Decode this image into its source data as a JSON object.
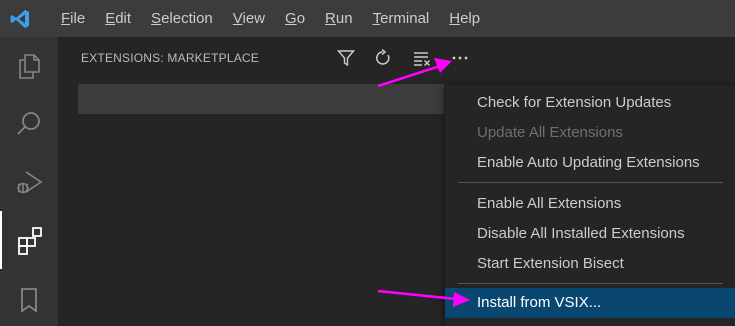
{
  "menubar": {
    "items": [
      {
        "pre": "",
        "mn": "F",
        "post": "ile"
      },
      {
        "pre": "",
        "mn": "E",
        "post": "dit"
      },
      {
        "pre": "",
        "mn": "S",
        "post": "election"
      },
      {
        "pre": "",
        "mn": "V",
        "post": "iew"
      },
      {
        "pre": "",
        "mn": "G",
        "post": "o"
      },
      {
        "pre": "",
        "mn": "R",
        "post": "un"
      },
      {
        "pre": "",
        "mn": "T",
        "post": "erminal"
      },
      {
        "pre": "",
        "mn": "H",
        "post": "elp"
      }
    ]
  },
  "sidebar": {
    "title": "EXTENSIONS: MARKETPLACE"
  },
  "context_menu": {
    "items": [
      {
        "label": "Check for Extension Updates",
        "state": "normal"
      },
      {
        "label": "Update All Extensions",
        "state": "disabled"
      },
      {
        "label": "Enable Auto Updating Extensions",
        "state": "normal"
      },
      {
        "label": "Enable All Extensions",
        "state": "normal"
      },
      {
        "label": "Disable All Installed Extensions",
        "state": "normal"
      },
      {
        "label": "Start Extension Bisect",
        "state": "normal"
      },
      {
        "label": "Install from VSIX...",
        "state": "selected"
      }
    ]
  },
  "icons": {
    "app": "vscode-logo-icon",
    "activity": [
      "explorer-icon",
      "search-icon",
      "run-debug-icon",
      "extensions-icon",
      "bookmark-icon"
    ],
    "sidebar_actions": [
      "filter-icon",
      "refresh-icon",
      "clear-list-icon",
      "more-actions-icon"
    ]
  },
  "colors": {
    "accent": "#094771",
    "annotation": "#ff00ff",
    "logo": "#3e9fe8"
  }
}
